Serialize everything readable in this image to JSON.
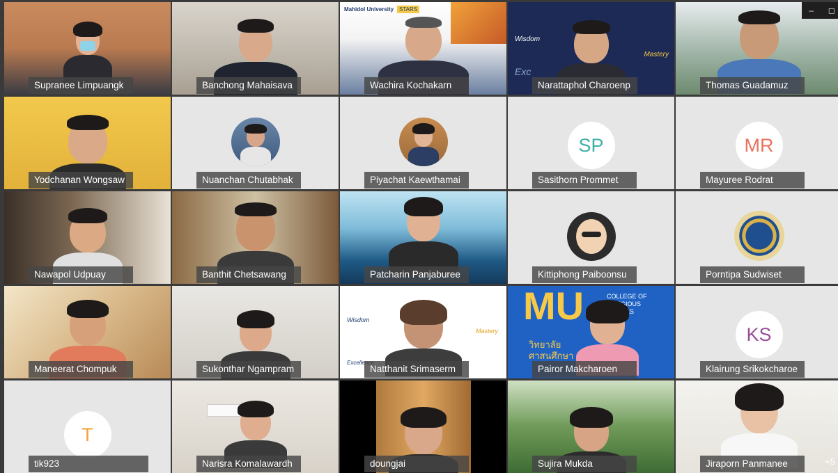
{
  "window": {
    "minimize": "–",
    "restore": "◻"
  },
  "participants": [
    {
      "name": "Supranee Limpuangk"
    },
    {
      "name": "Banchong Mahaisava"
    },
    {
      "name": "Wachira Kochakarn",
      "bg_text": [
        "Mahidol University",
        "STARS"
      ]
    },
    {
      "name": "Narattaphol Charoenp",
      "bg_text": [
        "Wisdom",
        "Mastery",
        "Exc"
      ]
    },
    {
      "name": "Thomas Guadamuz"
    },
    {
      "name": "Yodchanan Wongsaw"
    },
    {
      "name": "Nuanchan Chutabhak"
    },
    {
      "name": "Piyachat Kaewthamai"
    },
    {
      "name": "Sasithorn Prommet",
      "initials": "SP",
      "initials_color": "#3fb0a6"
    },
    {
      "name": "Mayuree Rodrat",
      "initials": "MR",
      "initials_color": "#e8735e"
    },
    {
      "name": "Nawapol Udpuay"
    },
    {
      "name": "Banthit Chetsawang"
    },
    {
      "name": "Patcharin Panjaburee"
    },
    {
      "name": "Kittiphong Paiboonsu"
    },
    {
      "name": "Porntipa Sudwiset"
    },
    {
      "name": "Maneerat Chompuk"
    },
    {
      "name": "Sukonthar Ngampram"
    },
    {
      "name": "Natthanit Srimaserm",
      "bg_text": [
        "Wisdom",
        "Mastery",
        "Excellence"
      ]
    },
    {
      "name": "Pairor Makcharoen",
      "bg_text": [
        "MU",
        "COLLEGE OF",
        "RELIGIOUS",
        "STUDIES",
        "วิทยาลัย",
        "ศาสนศึกษา"
      ]
    },
    {
      "name": "Klairung Srikokcharoe",
      "initials": "KS",
      "initials_color": "#9b4f9a"
    },
    {
      "name": "tik923",
      "initials": "T",
      "initials_color": "#f2a23a"
    },
    {
      "name": "Narisra Komalawardh"
    },
    {
      "name": "doungjai"
    },
    {
      "name": "Sujira Mukda"
    },
    {
      "name": "Jiraporn Panmanee"
    }
  ],
  "more_participants": "+5"
}
